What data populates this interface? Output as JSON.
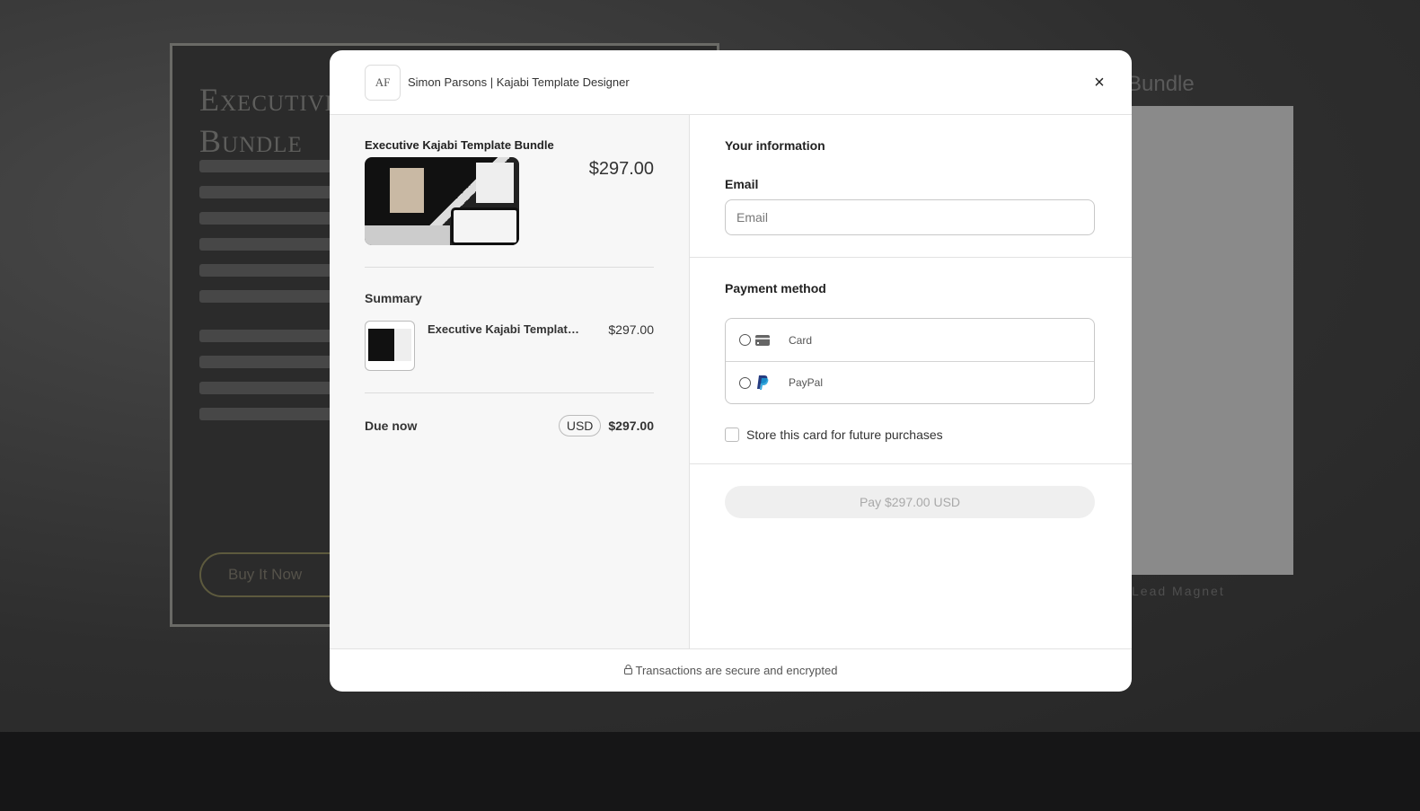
{
  "background": {
    "title_line1": "Executive",
    "title_line2": "Bundle",
    "buy_button": "Buy It Now",
    "right_title": "Bundle",
    "right_caption": "Lead Magnet"
  },
  "modal": {
    "logo_text": "AF",
    "store_name": "Simon Parsons | Kajabi Template Designer",
    "close_icon": "×",
    "product": {
      "title": "Executive Kajabi Template Bundle",
      "price": "$297.00"
    },
    "summary": {
      "heading": "Summary",
      "items": [
        {
          "name": "Executive Kajabi Template Bundle",
          "price": "$297.00"
        }
      ]
    },
    "due": {
      "label": "Due now",
      "currency": "USD",
      "amount": "$297.00"
    },
    "info": {
      "heading": "Your information",
      "email_label": "Email",
      "email_placeholder": "Email",
      "email_value": ""
    },
    "payment": {
      "heading": "Payment method",
      "options": [
        {
          "label": "Card",
          "icon": "credit-card-icon"
        },
        {
          "label": "PayPal",
          "icon": "paypal-icon"
        }
      ],
      "store_card_label": "Store this card for future purchases",
      "store_card_checked": false
    },
    "pay_button": "Pay $297.00 USD",
    "footer": "Transactions are secure and encrypted",
    "colors": {
      "paypal_dark": "#253b80",
      "paypal_light": "#179bd7"
    }
  }
}
